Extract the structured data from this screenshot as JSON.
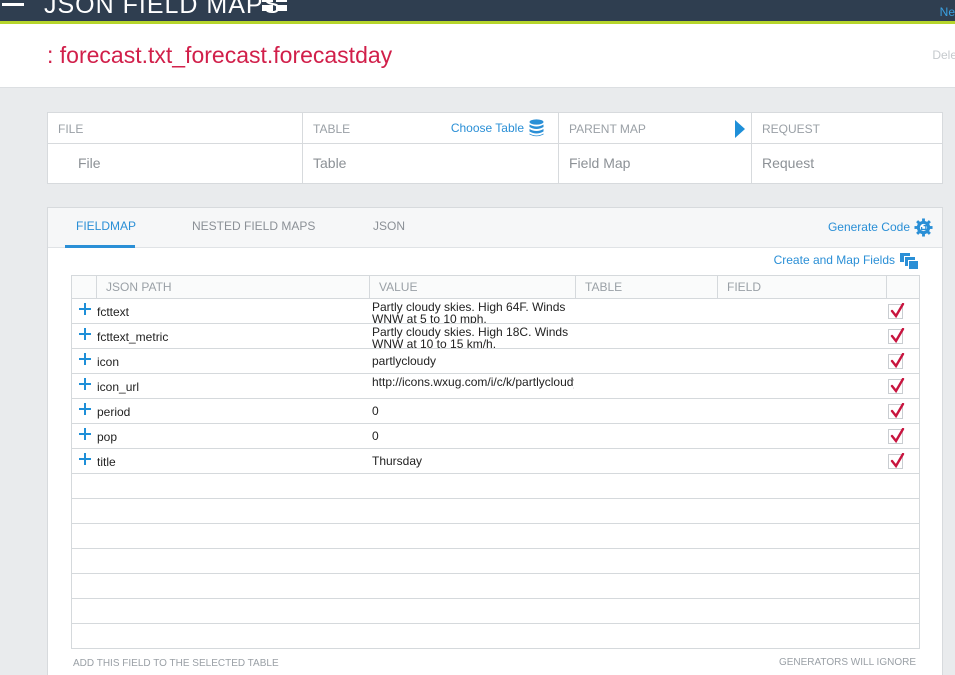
{
  "app": {
    "title": "JSON FIELD MAPS",
    "nav_link": "Ne"
  },
  "header": {
    "title": ": forecast.txt_forecast.forecastday",
    "delete_label": "Dele"
  },
  "info": {
    "columns": [
      {
        "head": "FILE",
        "value": "File"
      },
      {
        "head": "TABLE",
        "value": "Table",
        "action": "Choose Table"
      },
      {
        "head": "PARENT MAP",
        "value": "Field Map"
      },
      {
        "head": "REQUEST",
        "value": "Request"
      }
    ]
  },
  "tabs": [
    {
      "label": "FIELDMAP",
      "active": true
    },
    {
      "label": "NESTED FIELD MAPS",
      "active": false
    },
    {
      "label": "JSON",
      "active": false
    }
  ],
  "actions": {
    "generate_code": "Generate Code",
    "create_map_fields": "Create and Map Fields"
  },
  "grid": {
    "headers": [
      "JSON PATH",
      "VALUE",
      "TABLE",
      "FIELD"
    ],
    "rows": [
      {
        "path": "fcttext",
        "value": "Partly cloudy skies. High 64F. Winds WNW at 5 to 10 mph.",
        "checked": true
      },
      {
        "path": "fcttext_metric",
        "value": "Partly cloudy skies. High 18C. Winds WNW at 10 to 15 km/h.",
        "checked": true
      },
      {
        "path": "icon",
        "value": "partlycloudy",
        "checked": true
      },
      {
        "path": "icon_url",
        "value": "http://icons.wxug.com/i/c/k/partlycloudy.gif",
        "checked": true
      },
      {
        "path": "period",
        "value": "0",
        "checked": true
      },
      {
        "path": "pop",
        "value": "0",
        "checked": true
      },
      {
        "path": "title",
        "value": "Thursday",
        "checked": true
      }
    ]
  },
  "footer": {
    "left": "ADD THIS FIELD TO THE SELECTED TABLE",
    "right": "GENERATORS WILL IGNORE"
  },
  "colors": {
    "accent": "#2a8fd6",
    "title": "#d11f4a",
    "topbar": "#2f3e50",
    "lime": "#b6d52c",
    "check": "#c8143e"
  }
}
